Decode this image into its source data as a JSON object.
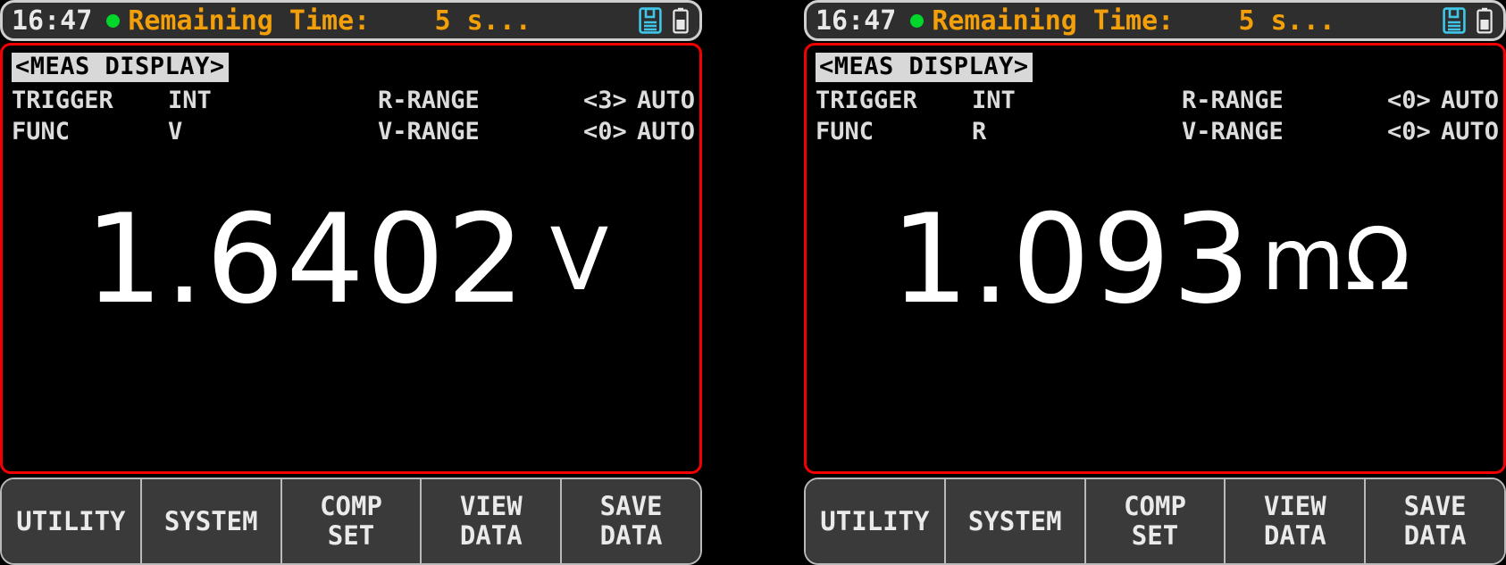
{
  "device": {
    "accent_border": "#f40000",
    "status_text_color": "#f29f0a",
    "status_bg": "#2e2e2e",
    "led_color": "#00d72a",
    "floppy_icon_color": "#3fc6e8",
    "value_color": "#ffffff"
  },
  "panels": [
    {
      "statusbar": {
        "clock": "16:47",
        "led": "status-led-green",
        "message": "Remaining Time:    5 s...",
        "icons": [
          {
            "name": "floppy-disk-icon",
            "label": "save-media"
          },
          {
            "name": "battery-icon",
            "label": "battery"
          }
        ]
      },
      "title": "<MEAS DISPLAY>",
      "params": [
        {
          "label": "TRIGGER",
          "value": "INT",
          "label2": "R-RANGE",
          "index": "<3>",
          "mode": "AUTO"
        },
        {
          "label": "FUNC",
          "value": "V",
          "label2": "V-RANGE",
          "index": "<0>",
          "mode": "AUTO"
        }
      ],
      "reading": {
        "value": "1.6402",
        "unit": "V",
        "unit_tight": false
      },
      "softkeys": [
        {
          "line1": "UTILITY",
          "line2": ""
        },
        {
          "line1": "SYSTEM",
          "line2": ""
        },
        {
          "line1": "COMP",
          "line2": "SET"
        },
        {
          "line1": "VIEW",
          "line2": "DATA"
        },
        {
          "line1": "SAVE",
          "line2": "DATA"
        }
      ]
    },
    {
      "statusbar": {
        "clock": "16:47",
        "led": "status-led-green",
        "message": "Remaining Time:    5 s...",
        "icons": [
          {
            "name": "floppy-disk-icon",
            "label": "save-media"
          },
          {
            "name": "battery-icon",
            "label": "battery"
          }
        ]
      },
      "title": "<MEAS DISPLAY>",
      "params": [
        {
          "label": "TRIGGER",
          "value": "INT",
          "label2": "R-RANGE",
          "index": "<0>",
          "mode": "AUTO"
        },
        {
          "label": "FUNC",
          "value": "R",
          "label2": "V-RANGE",
          "index": "<0>",
          "mode": "AUTO"
        }
      ],
      "reading": {
        "value": "1.093",
        "unit": "mΩ",
        "unit_tight": true
      },
      "softkeys": [
        {
          "line1": "UTILITY",
          "line2": ""
        },
        {
          "line1": "SYSTEM",
          "line2": ""
        },
        {
          "line1": "COMP",
          "line2": "SET"
        },
        {
          "line1": "VIEW",
          "line2": "DATA"
        },
        {
          "line1": "SAVE",
          "line2": "DATA"
        }
      ]
    }
  ]
}
